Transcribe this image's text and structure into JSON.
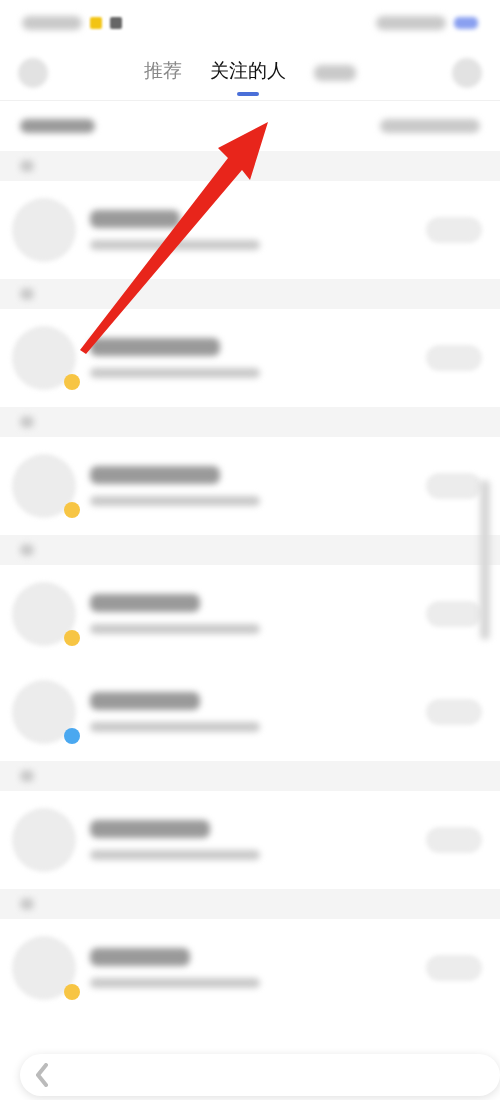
{
  "tabs": [
    {
      "label": "推荐",
      "selected": false
    },
    {
      "label": "关注的人",
      "selected": true
    }
  ],
  "groups": [
    {
      "contacts": [
        {
          "badge": false
        }
      ]
    },
    {
      "contacts": [
        {
          "badge": true,
          "color": "#f7c544"
        }
      ]
    },
    {
      "contacts": [
        {
          "badge": true,
          "color": "#f7c544"
        }
      ]
    },
    {
      "contacts": [
        {
          "badge": true,
          "color": "#f7c544"
        },
        {
          "badge": true,
          "color": "#4aa8f0"
        }
      ]
    },
    {
      "contacts": [
        {
          "badge": false
        }
      ]
    },
    {
      "contacts": [
        {
          "badge": true,
          "color": "#f7c544"
        }
      ]
    }
  ]
}
